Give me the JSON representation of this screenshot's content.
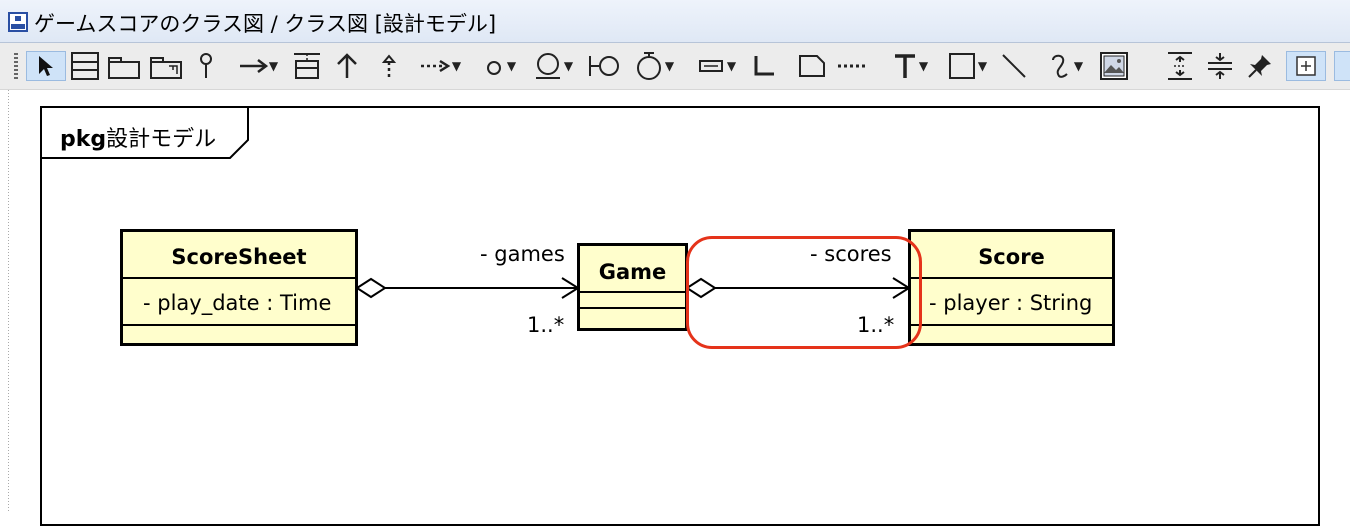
{
  "window": {
    "title": "ゲームスコアのクラス図 / クラス図 [設計モデル]"
  },
  "toolbar": {
    "tools": [
      {
        "name": "select-tool-icon"
      },
      {
        "name": "class-tool-icon"
      },
      {
        "name": "package-tool-icon"
      },
      {
        "name": "subsystem-tool-icon"
      },
      {
        "name": "interface-tool-icon"
      },
      {
        "name": "association-tool-icon"
      },
      {
        "name": "association-class-tool-icon"
      },
      {
        "name": "generalization-tool-icon"
      },
      {
        "name": "realization-tool-icon"
      },
      {
        "name": "dependency-tool-icon"
      },
      {
        "name": "lollipop-interface-tool-icon"
      },
      {
        "name": "required-interface-tool-icon"
      },
      {
        "name": "port-tool-icon"
      },
      {
        "name": "instance-tool-icon"
      },
      {
        "name": "constraint-tool-icon"
      },
      {
        "name": "note-tool-icon"
      },
      {
        "name": "note-anchor-tool-icon"
      },
      {
        "name": "text-tool-icon"
      },
      {
        "name": "rectangle-tool-icon"
      },
      {
        "name": "line-tool-icon"
      },
      {
        "name": "freehand-tool-icon"
      },
      {
        "name": "image-tool-icon"
      },
      {
        "name": "expand-space-tool-icon"
      },
      {
        "name": "shrink-space-tool-icon"
      },
      {
        "name": "pin-tool-icon"
      },
      {
        "name": "zoom-in-icon"
      }
    ]
  },
  "diagram": {
    "package_keyword": "pkg",
    "package_name": "設計モデル",
    "classes": {
      "score_sheet": {
        "name": "ScoreSheet",
        "attribute": "- play_date : Time"
      },
      "game": {
        "name": "Game"
      },
      "score": {
        "name": "Score",
        "attribute": "- player : String"
      }
    },
    "associations": {
      "games": {
        "role": "- games",
        "multiplicity": "1..*"
      },
      "scores": {
        "role": "- scores",
        "multiplicity": "1..*"
      }
    },
    "highlight_color": "#e5331a",
    "class_fill_color": "#fffecc"
  }
}
